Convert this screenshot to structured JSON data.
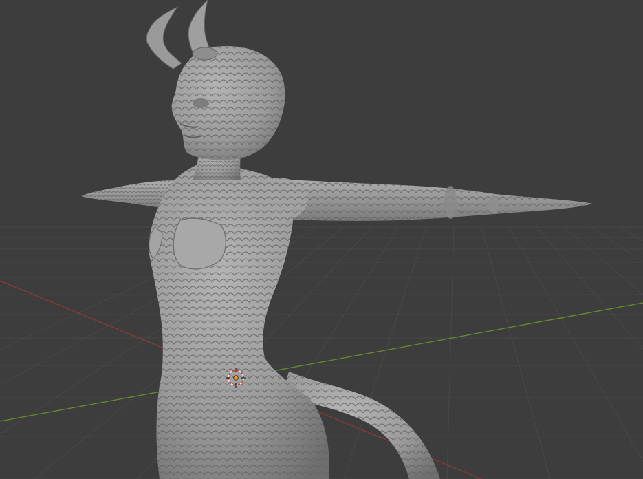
{
  "app": "Blender",
  "viewport": {
    "background_color": "#3d3d3d",
    "grid_color": "#4a4a4a",
    "x_axis_color": "#8b3a3a",
    "y_axis_color": "#6b8a2e",
    "model": {
      "name": "scaled-demon-figure",
      "color": "#9a9a9a",
      "pose": "T-pose",
      "features": [
        "horns",
        "scales",
        "tail"
      ]
    },
    "cursor_3d_icon": "3d-cursor-icon",
    "origin_icon": "object-origin-icon"
  }
}
